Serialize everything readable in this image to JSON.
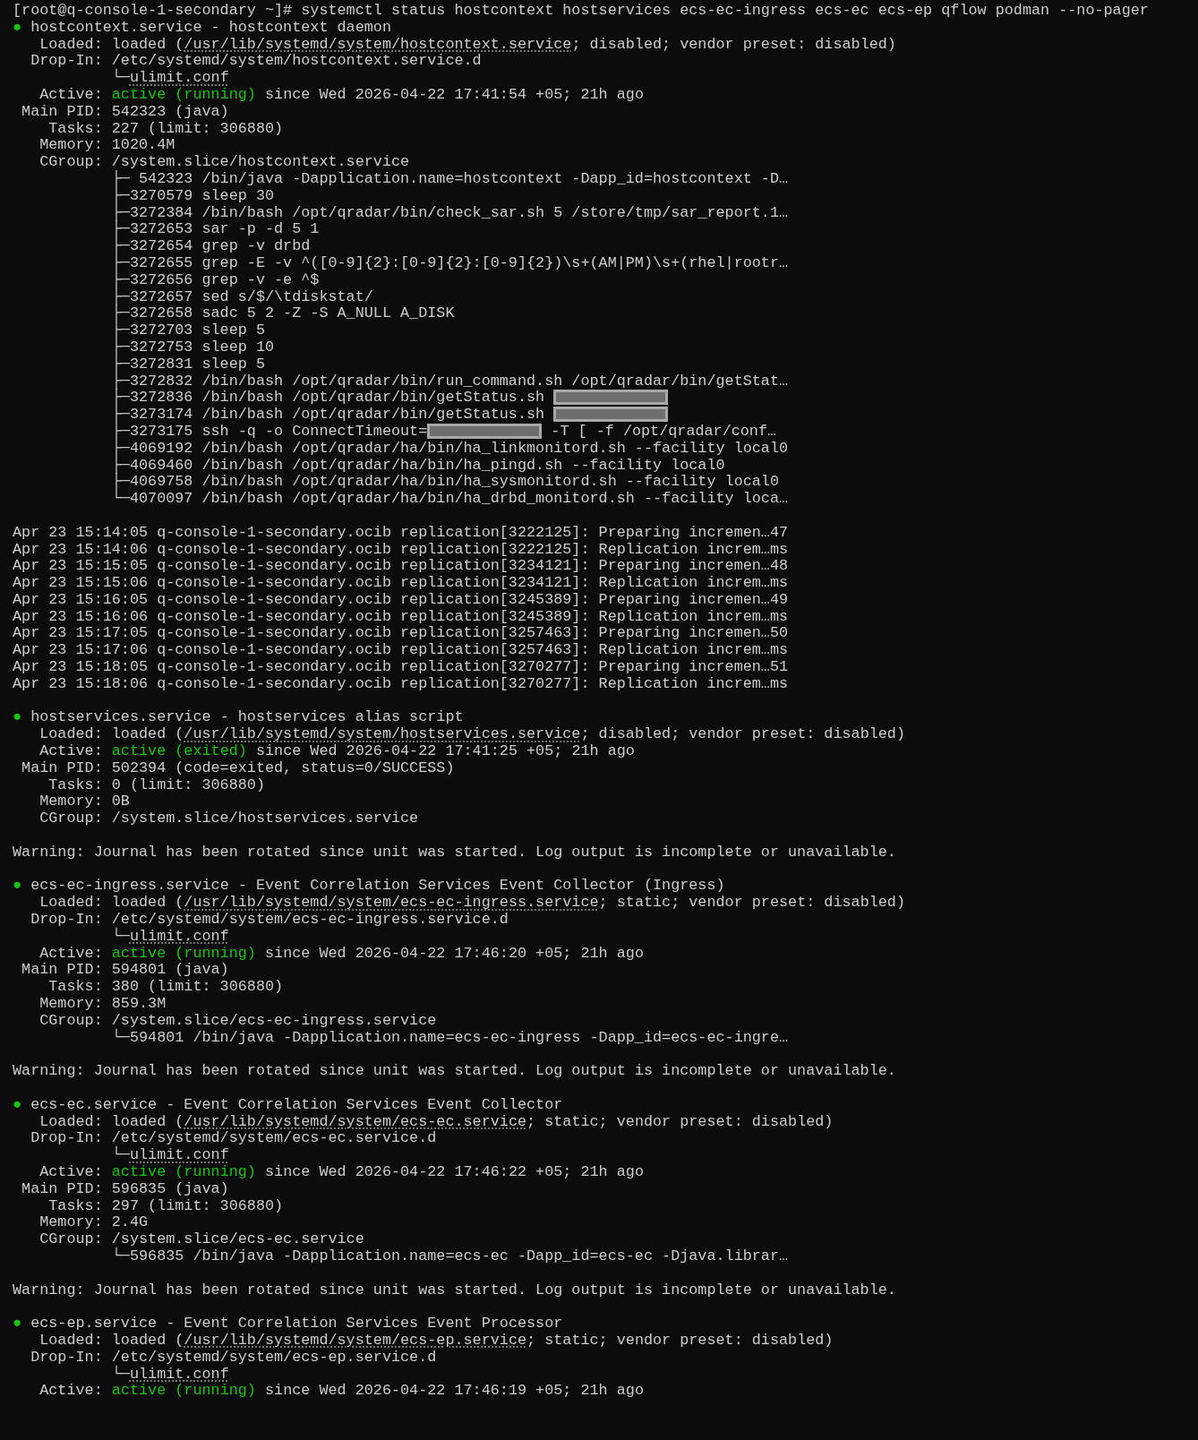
{
  "terminal": {
    "lines": [
      {
        "kind": "plain",
        "text": "[root@q-console-1-secondary ~]# systemctl status hostcontext hostservices ecs-ec-ingress ecs-ec ecs-ep qflow podman --no-pager"
      },
      {
        "kind": "mixed",
        "segments": [
          {
            "kind": "bullet",
            "text": "●"
          },
          {
            "kind": "text",
            "text": " hostcontext.service - hostcontext daemon"
          }
        ]
      },
      {
        "kind": "mixed",
        "segments": [
          {
            "kind": "text",
            "text": "   Loaded: loaded ("
          },
          {
            "kind": "path",
            "text": "/usr/lib/systemd/system/hostcontext.service"
          },
          {
            "kind": "text",
            "text": "; disabled; vendor preset: disabled)"
          }
        ]
      },
      {
        "kind": "plain",
        "text": "  Drop-In: /etc/systemd/system/hostcontext.service.d"
      },
      {
        "kind": "mixed",
        "segments": [
          {
            "kind": "text",
            "text": "           └─"
          },
          {
            "kind": "path",
            "text": "ulimit.conf"
          }
        ]
      },
      {
        "kind": "mixed",
        "segments": [
          {
            "kind": "text",
            "text": "   Active: "
          },
          {
            "kind": "status",
            "text": "active (running)"
          },
          {
            "kind": "text",
            "text": " since Wed 2026-04-22 17:41:54 +05; 21h ago"
          }
        ]
      },
      {
        "kind": "plain",
        "text": " Main PID: 542323 (java)"
      },
      {
        "kind": "plain",
        "text": "    Tasks: 227 (limit: 306880)"
      },
      {
        "kind": "plain",
        "text": "   Memory: 1020.4M"
      },
      {
        "kind": "plain",
        "text": "   CGroup: /system.slice/hostcontext.service"
      },
      {
        "kind": "plain",
        "text": "           ├─ 542323 /bin/java -Dapplication.name=hostcontext -Dapp_id=hostcontext -D…"
      },
      {
        "kind": "plain",
        "text": "           ├─3270579 sleep 30"
      },
      {
        "kind": "plain",
        "text": "           ├─3272384 /bin/bash /opt/qradar/bin/check_sar.sh 5 /store/tmp/sar_report.1…"
      },
      {
        "kind": "plain",
        "text": "           ├─3272653 sar -p -d 5 1"
      },
      {
        "kind": "plain",
        "text": "           ├─3272654 grep -v drbd"
      },
      {
        "kind": "plain",
        "text": "           ├─3272655 grep -E -v ^([0-9]{2}:[0-9]{2}:[0-9]{2})\\s+(AM|PM)\\s+(rhel|rootr…"
      },
      {
        "kind": "plain",
        "text": "           ├─3272656 grep -v -e ^$"
      },
      {
        "kind": "plain",
        "text": "           ├─3272657 sed s/$/\\tdiskstat/"
      },
      {
        "kind": "plain",
        "text": "           ├─3272658 sadc 5 2 -Z -S A_NULL A_DISK"
      },
      {
        "kind": "plain",
        "text": "           ├─3272703 sleep 5"
      },
      {
        "kind": "plain",
        "text": "           ├─3272753 sleep 10"
      },
      {
        "kind": "plain",
        "text": "           ├─3272831 sleep 5"
      },
      {
        "kind": "plain",
        "text": "           ├─3272832 /bin/bash /opt/qradar/bin/run_command.sh /opt/qradar/bin/getStat…"
      },
      {
        "kind": "mixed",
        "segments": [
          {
            "kind": "text",
            "text": "           ├─3272836 /bin/bash /opt/qradar/bin/getStatus.sh "
          },
          {
            "kind": "redacted"
          }
        ]
      },
      {
        "kind": "mixed",
        "segments": [
          {
            "kind": "text",
            "text": "           ├─3273174 /bin/bash /opt/qradar/bin/getStatus.sh "
          },
          {
            "kind": "redacted"
          }
        ]
      },
      {
        "kind": "mixed",
        "segments": [
          {
            "kind": "text",
            "text": "           ├─3273175 ssh -q -o ConnectTimeout="
          },
          {
            "kind": "redacted"
          },
          {
            "kind": "text",
            "text": " -T [ -f /opt/qradar/conf…"
          }
        ]
      },
      {
        "kind": "plain",
        "text": "           ├─4069192 /bin/bash /opt/qradar/ha/bin/ha_linkmonitord.sh --facility local0"
      },
      {
        "kind": "plain",
        "text": "           ├─4069460 /bin/bash /opt/qradar/ha/bin/ha_pingd.sh --facility local0"
      },
      {
        "kind": "plain",
        "text": "           ├─4069758 /bin/bash /opt/qradar/ha/bin/ha_sysmonitord.sh --facility local0"
      },
      {
        "kind": "plain",
        "text": "           └─4070097 /bin/bash /opt/qradar/ha/bin/ha_drbd_monitord.sh --facility loca…"
      },
      {
        "kind": "blank"
      },
      {
        "kind": "plain",
        "text": "Apr 23 15:14:05 q-console-1-secondary.ocib replication[3222125]: Preparing incremen…47"
      },
      {
        "kind": "plain",
        "text": "Apr 23 15:14:06 q-console-1-secondary.ocib replication[3222125]: Replication increm…ms"
      },
      {
        "kind": "plain",
        "text": "Apr 23 15:15:05 q-console-1-secondary.ocib replication[3234121]: Preparing incremen…48"
      },
      {
        "kind": "plain",
        "text": "Apr 23 15:15:06 q-console-1-secondary.ocib replication[3234121]: Replication increm…ms"
      },
      {
        "kind": "plain",
        "text": "Apr 23 15:16:05 q-console-1-secondary.ocib replication[3245389]: Preparing incremen…49"
      },
      {
        "kind": "plain",
        "text": "Apr 23 15:16:06 q-console-1-secondary.ocib replication[3245389]: Replication increm…ms"
      },
      {
        "kind": "plain",
        "text": "Apr 23 15:17:05 q-console-1-secondary.ocib replication[3257463]: Preparing incremen…50"
      },
      {
        "kind": "plain",
        "text": "Apr 23 15:17:06 q-console-1-secondary.ocib replication[3257463]: Replication increm…ms"
      },
      {
        "kind": "plain",
        "text": "Apr 23 15:18:05 q-console-1-secondary.ocib replication[3270277]: Preparing incremen…51"
      },
      {
        "kind": "plain",
        "text": "Apr 23 15:18:06 q-console-1-secondary.ocib replication[3270277]: Replication increm…ms"
      },
      {
        "kind": "blank"
      },
      {
        "kind": "mixed",
        "segments": [
          {
            "kind": "bullet",
            "text": "●"
          },
          {
            "kind": "text",
            "text": " hostservices.service - hostservices alias script"
          }
        ]
      },
      {
        "kind": "mixed",
        "segments": [
          {
            "kind": "text",
            "text": "   Loaded: loaded ("
          },
          {
            "kind": "path",
            "text": "/usr/lib/systemd/system/hostservices.service"
          },
          {
            "kind": "text",
            "text": "; disabled; vendor preset: disabled)"
          }
        ]
      },
      {
        "kind": "mixed",
        "segments": [
          {
            "kind": "text",
            "text": "   Active: "
          },
          {
            "kind": "status",
            "text": "active (exited)"
          },
          {
            "kind": "text",
            "text": " since Wed 2026-04-22 17:41:25 +05; 21h ago"
          }
        ]
      },
      {
        "kind": "plain",
        "text": " Main PID: 502394 (code=exited, status=0/SUCCESS)"
      },
      {
        "kind": "plain",
        "text": "    Tasks: 0 (limit: 306880)"
      },
      {
        "kind": "plain",
        "text": "   Memory: 0B"
      },
      {
        "kind": "plain",
        "text": "   CGroup: /system.slice/hostservices.service"
      },
      {
        "kind": "blank"
      },
      {
        "kind": "plain",
        "text": "Warning: Journal has been rotated since unit was started. Log output is incomplete or unavailable."
      },
      {
        "kind": "blank"
      },
      {
        "kind": "mixed",
        "segments": [
          {
            "kind": "bullet",
            "text": "●"
          },
          {
            "kind": "text",
            "text": " ecs-ec-ingress.service - Event Correlation Services Event Collector (Ingress)"
          }
        ]
      },
      {
        "kind": "mixed",
        "segments": [
          {
            "kind": "text",
            "text": "   Loaded: loaded ("
          },
          {
            "kind": "path",
            "text": "/usr/lib/systemd/system/ecs-ec-ingress.service"
          },
          {
            "kind": "text",
            "text": "; static; vendor preset: disabled)"
          }
        ]
      },
      {
        "kind": "plain",
        "text": "  Drop-In: /etc/systemd/system/ecs-ec-ingress.service.d"
      },
      {
        "kind": "mixed",
        "segments": [
          {
            "kind": "text",
            "text": "           └─"
          },
          {
            "kind": "path",
            "text": "ulimit.conf"
          }
        ]
      },
      {
        "kind": "mixed",
        "segments": [
          {
            "kind": "text",
            "text": "   Active: "
          },
          {
            "kind": "status",
            "text": "active (running)"
          },
          {
            "kind": "text",
            "text": " since Wed 2026-04-22 17:46:20 +05; 21h ago"
          }
        ]
      },
      {
        "kind": "plain",
        "text": " Main PID: 594801 (java)"
      },
      {
        "kind": "plain",
        "text": "    Tasks: 380 (limit: 306880)"
      },
      {
        "kind": "plain",
        "text": "   Memory: 859.3M"
      },
      {
        "kind": "plain",
        "text": "   CGroup: /system.slice/ecs-ec-ingress.service"
      },
      {
        "kind": "plain",
        "text": "           └─594801 /bin/java -Dapplication.name=ecs-ec-ingress -Dapp_id=ecs-ec-ingre…"
      },
      {
        "kind": "blank"
      },
      {
        "kind": "plain",
        "text": "Warning: Journal has been rotated since unit was started. Log output is incomplete or unavailable."
      },
      {
        "kind": "blank"
      },
      {
        "kind": "mixed",
        "segments": [
          {
            "kind": "bullet",
            "text": "●"
          },
          {
            "kind": "text",
            "text": " ecs-ec.service - Event Correlation Services Event Collector"
          }
        ]
      },
      {
        "kind": "mixed",
        "segments": [
          {
            "kind": "text",
            "text": "   Loaded: loaded ("
          },
          {
            "kind": "path",
            "text": "/usr/lib/systemd/system/ecs-ec.service"
          },
          {
            "kind": "text",
            "text": "; static; vendor preset: disabled)"
          }
        ]
      },
      {
        "kind": "plain",
        "text": "  Drop-In: /etc/systemd/system/ecs-ec.service.d"
      },
      {
        "kind": "mixed",
        "segments": [
          {
            "kind": "text",
            "text": "           └─"
          },
          {
            "kind": "path",
            "text": "ulimit.conf"
          }
        ]
      },
      {
        "kind": "mixed",
        "segments": [
          {
            "kind": "text",
            "text": "   Active: "
          },
          {
            "kind": "status",
            "text": "active (running)"
          },
          {
            "kind": "text",
            "text": " since Wed 2026-04-22 17:46:22 +05; 21h ago"
          }
        ]
      },
      {
        "kind": "plain",
        "text": " Main PID: 596835 (java)"
      },
      {
        "kind": "plain",
        "text": "    Tasks: 297 (limit: 306880)"
      },
      {
        "kind": "plain",
        "text": "   Memory: 2.4G"
      },
      {
        "kind": "plain",
        "text": "   CGroup: /system.slice/ecs-ec.service"
      },
      {
        "kind": "plain",
        "text": "           └─596835 /bin/java -Dapplication.name=ecs-ec -Dapp_id=ecs-ec -Djava.librar…"
      },
      {
        "kind": "blank"
      },
      {
        "kind": "plain",
        "text": "Warning: Journal has been rotated since unit was started. Log output is incomplete or unavailable."
      },
      {
        "kind": "blank"
      },
      {
        "kind": "mixed",
        "segments": [
          {
            "kind": "bullet",
            "text": "●"
          },
          {
            "kind": "text",
            "text": " ecs-ep.service - Event Correlation Services Event Processor"
          }
        ]
      },
      {
        "kind": "mixed",
        "segments": [
          {
            "kind": "text",
            "text": "   Loaded: loaded ("
          },
          {
            "kind": "path",
            "text": "/usr/lib/systemd/system/ecs-ep.service"
          },
          {
            "kind": "text",
            "text": "; static; vendor preset: disabled)"
          }
        ]
      },
      {
        "kind": "plain",
        "text": "  Drop-In: /etc/systemd/system/ecs-ep.service.d"
      },
      {
        "kind": "mixed",
        "segments": [
          {
            "kind": "text",
            "text": "           └─"
          },
          {
            "kind": "path",
            "text": "ulimit.conf"
          }
        ]
      },
      {
        "kind": "mixed",
        "segments": [
          {
            "kind": "text",
            "text": "   Active: "
          },
          {
            "kind": "status",
            "text": "active (running)"
          },
          {
            "kind": "text",
            "text": " since Wed 2026-04-22 17:46:19 +05; 21h ago"
          }
        ]
      }
    ]
  }
}
